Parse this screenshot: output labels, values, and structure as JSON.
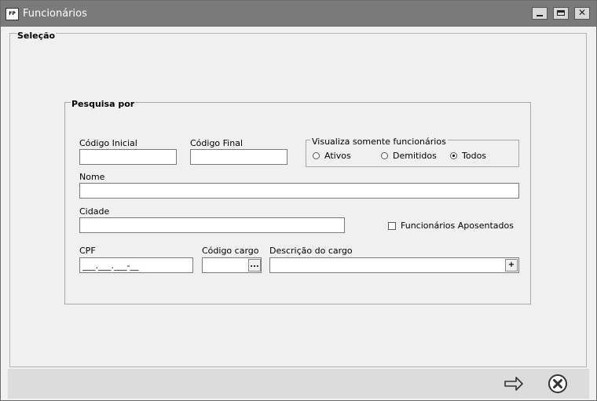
{
  "window": {
    "title": "Funcionários",
    "icon_text": "FP"
  },
  "selecao": {
    "legend": "Seleção"
  },
  "pesquisa": {
    "legend": "Pesquisa por",
    "codigo_inicial": {
      "label": "Código Inicial",
      "value": ""
    },
    "codigo_final": {
      "label": "Código Final",
      "value": ""
    },
    "visualiza": {
      "legend": "Visualiza somente funcionários",
      "options": [
        "Ativos",
        "Demitidos",
        "Todos"
      ],
      "selected": "Todos"
    },
    "nome": {
      "label": "Nome",
      "value": ""
    },
    "cidade": {
      "label": "Cidade",
      "value": ""
    },
    "aposentados": {
      "label": "Funcionários Aposentados",
      "checked": false
    },
    "cpf": {
      "label": "CPF",
      "value": "___.___.___-__"
    },
    "codigo_cargo": {
      "label": "Código cargo",
      "value": "",
      "button": "..."
    },
    "descricao_cargo": {
      "label": "Descrição do cargo",
      "value": "",
      "button": "+"
    }
  },
  "colors": {
    "titlebar": "#7a7a7a",
    "footer": "#dcdcdc",
    "background": "#f0f0f0"
  },
  "footer": {
    "confirm_icon": "arrow-right-icon",
    "cancel_icon": "cancel-circle-icon"
  }
}
